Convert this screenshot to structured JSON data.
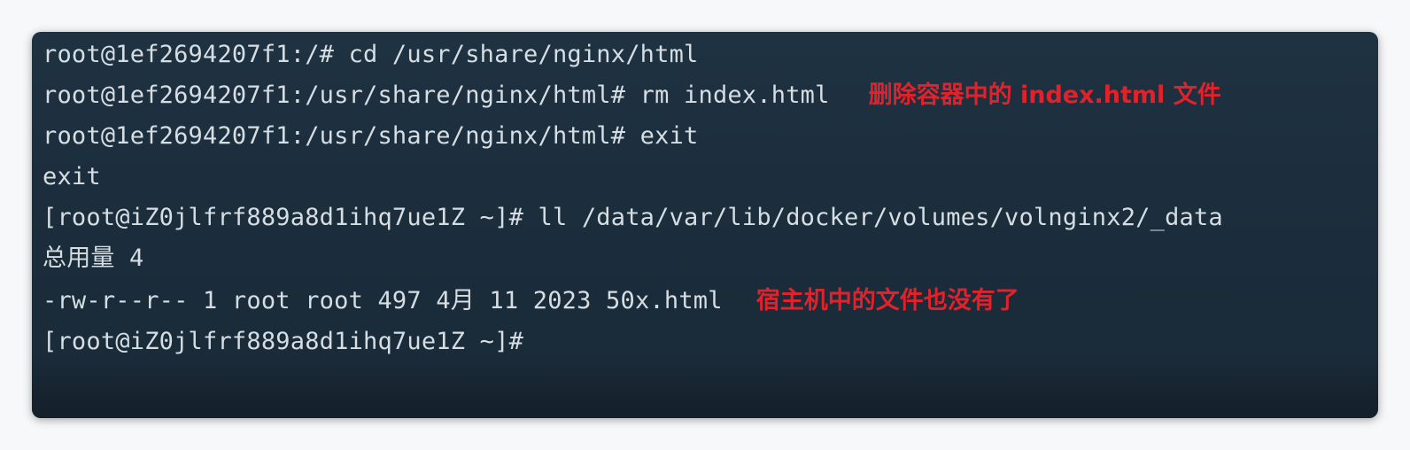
{
  "terminal": {
    "lines": [
      {
        "text": "root@1ef2694207f1:/# cd  /usr/share/nginx/html",
        "note": ""
      },
      {
        "text": "root@1ef2694207f1:/usr/share/nginx/html# rm index.html",
        "note": "删除容器中的 index.html 文件"
      },
      {
        "text": "root@1ef2694207f1:/usr/share/nginx/html# exit",
        "note": ""
      },
      {
        "text": "exit",
        "note": ""
      },
      {
        "text": "[root@iZ0jlfrf889a8d1ihq7ue1Z ~]# ll  /data/var/lib/docker/volumes/volnginx2/_data",
        "note": ""
      },
      {
        "text": "总用量 4",
        "note": ""
      },
      {
        "text": "-rw-r--r-- 1 root root 497 4月  11 2023 50x.html",
        "note": "宿主机中的文件也没有了"
      },
      {
        "text": "[root@iZ0jlfrf889a8d1ihq7ue1Z ~]#",
        "note": ""
      }
    ],
    "colors": {
      "background": "#1c2e3d",
      "text": "#d6dde3",
      "annotation": "#e2222a"
    }
  }
}
